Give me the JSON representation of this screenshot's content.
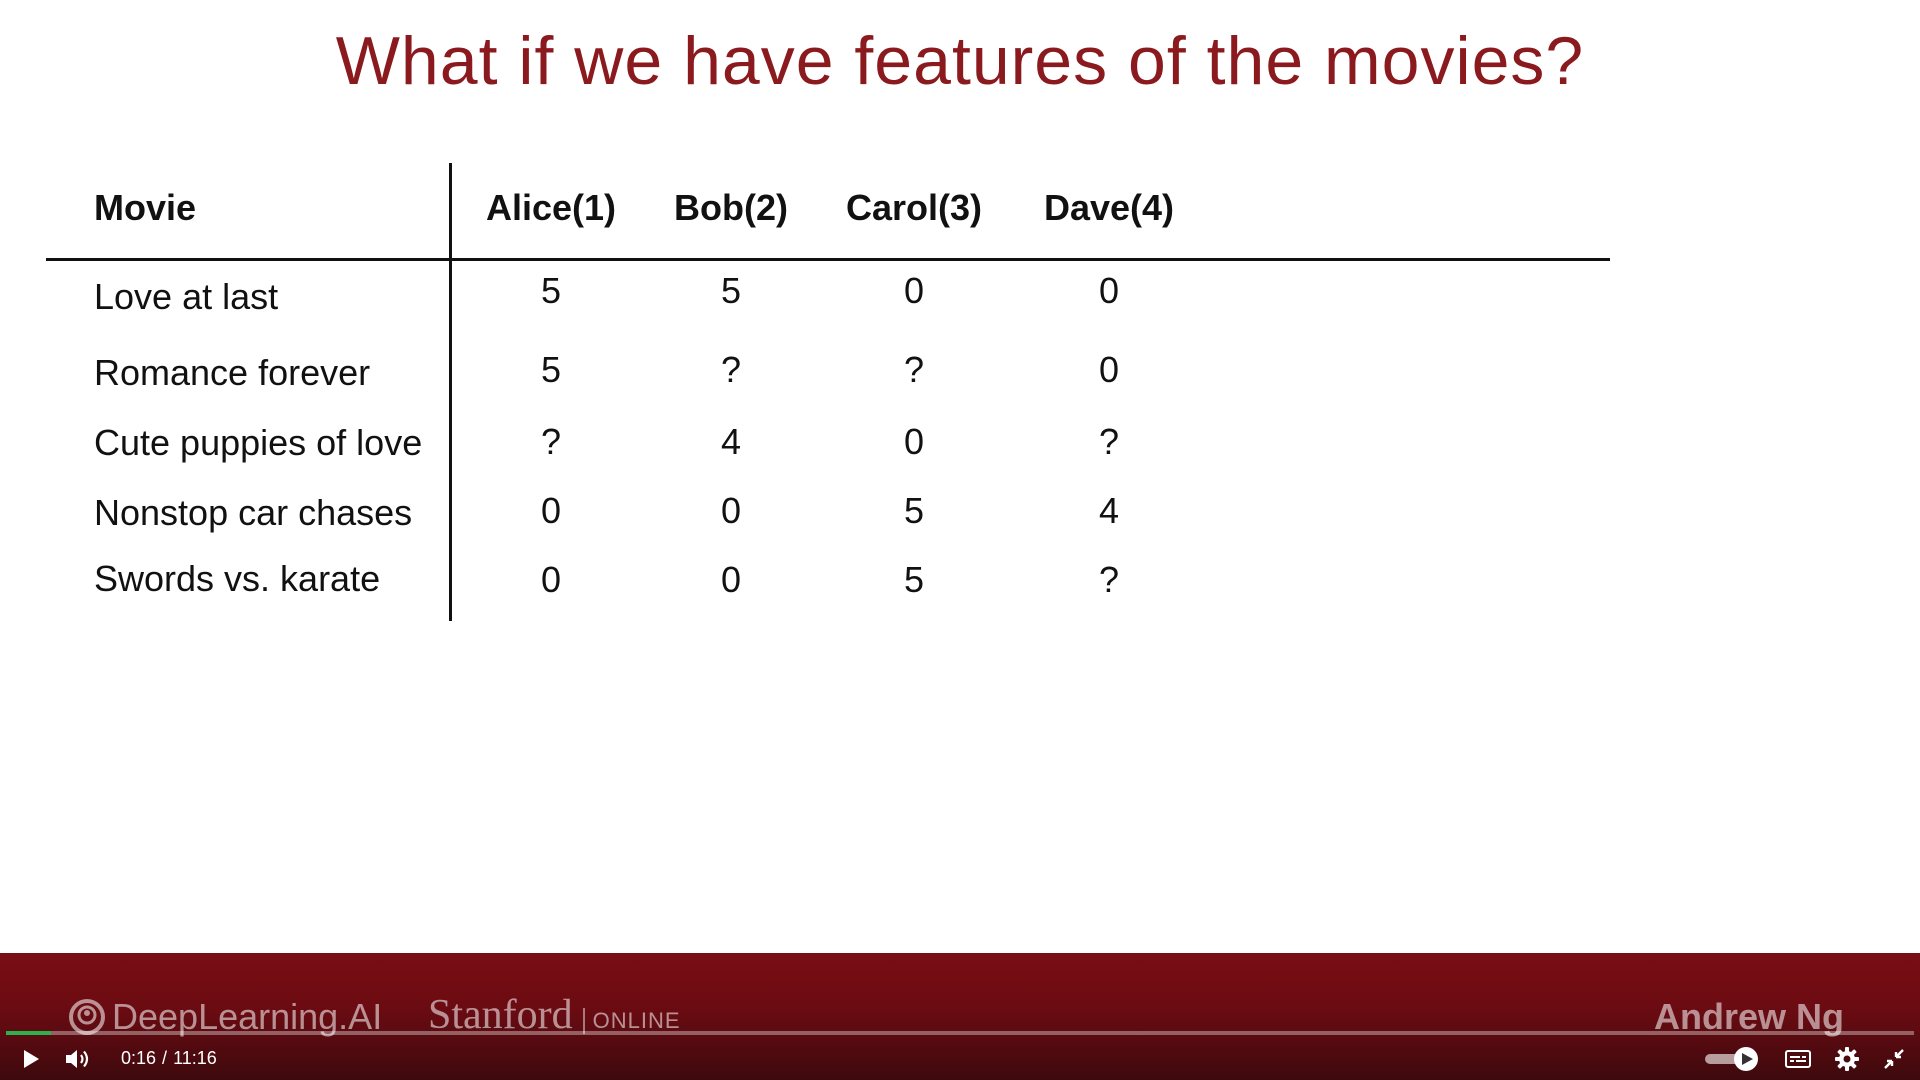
{
  "slide": {
    "title": "What if we have features of the movies?",
    "table": {
      "movie_header": "Movie",
      "users": [
        "Alice(1)",
        "Bob(2)",
        "Carol(3)",
        "Dave(4)"
      ],
      "rows": [
        {
          "movie": "Love at last",
          "ratings": [
            "5",
            "5",
            "0",
            "0"
          ]
        },
        {
          "movie": "Romance forever",
          "ratings": [
            "5",
            "?",
            "?",
            "0"
          ]
        },
        {
          "movie": "Cute puppies of love",
          "ratings": [
            "?",
            "4",
            "0",
            "?"
          ]
        },
        {
          "movie": "Nonstop car chases",
          "ratings": [
            "0",
            "0",
            "5",
            "4"
          ]
        },
        {
          "movie": "Swords vs. karate",
          "ratings": [
            "0",
            "0",
            "5",
            "?"
          ]
        }
      ]
    }
  },
  "footer": {
    "brand_deeplearning": "DeepLearning.AI",
    "brand_stanford": "Stanford",
    "brand_online": "ONLINE",
    "author": "Andrew Ng",
    "background_color": "#6a0b12"
  },
  "player": {
    "current_time": "0:16",
    "separator": "/",
    "duration": "11:16",
    "progress_fraction": 0.0237,
    "progress_color": "#2bb24c",
    "autoplay_toggle": "on",
    "icons": {
      "play": "play-icon",
      "volume": "volume-icon",
      "autoplay": "autoplay-toggle-icon",
      "captions": "captions-icon",
      "settings": "gear-icon",
      "fullscreen": "exit-fullscreen-icon"
    }
  }
}
